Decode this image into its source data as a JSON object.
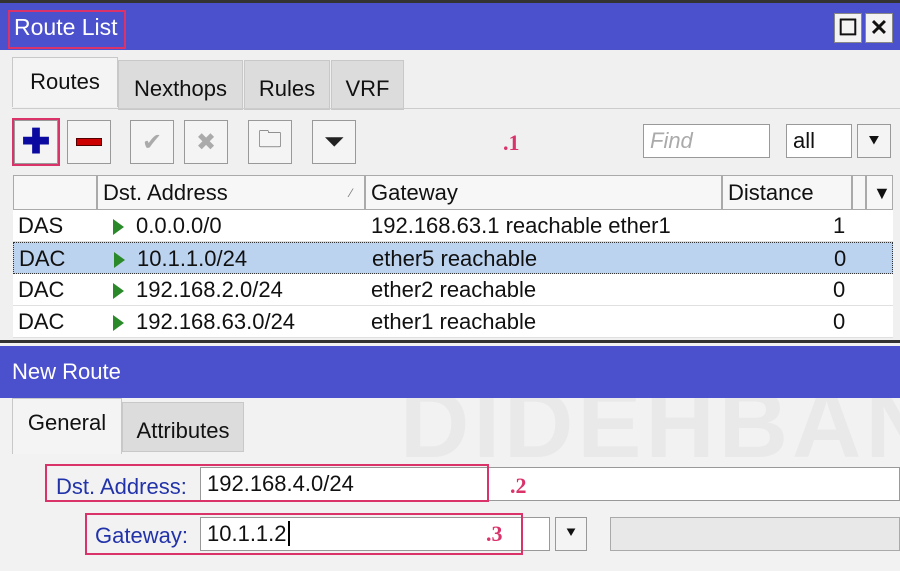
{
  "route_list": {
    "title": "Route List",
    "tabs": [
      "Routes",
      "Nexthops",
      "Rules",
      "VRF"
    ],
    "toolbar": {
      "find_placeholder": "Find",
      "filter_value": "all",
      "step_label": ".1"
    },
    "columns": [
      "",
      "Dst. Address",
      "Gateway",
      "Distance"
    ],
    "rows": [
      {
        "flags": "DAS",
        "dst": "0.0.0.0/0",
        "gateway": "192.168.63.1 reachable ether1",
        "distance": "1"
      },
      {
        "flags": "DAC",
        "dst": "10.1.1.0/24",
        "gateway": "ether5 reachable",
        "distance": "0",
        "selected": true
      },
      {
        "flags": "DAC",
        "dst": "192.168.2.0/24",
        "gateway": "ether2 reachable",
        "distance": "0"
      },
      {
        "flags": "DAC",
        "dst": "192.168.63.0/24",
        "gateway": "ether1 reachable",
        "distance": "0"
      }
    ]
  },
  "new_route": {
    "title": "New Route",
    "tabs": [
      "General",
      "Attributes"
    ],
    "dst_label": "Dst. Address:",
    "dst_value": "192.168.4.0/24",
    "gateway_label": "Gateway:",
    "gateway_value": "10.1.1.2",
    "step2": ".2",
    "step3": ".3"
  },
  "watermark": "DIDEHBAN",
  "colors": {
    "titlebar": "#4b50cc",
    "highlight": "#d9336a",
    "selected_row": "#bcd3f0",
    "label": "#2233aa"
  }
}
